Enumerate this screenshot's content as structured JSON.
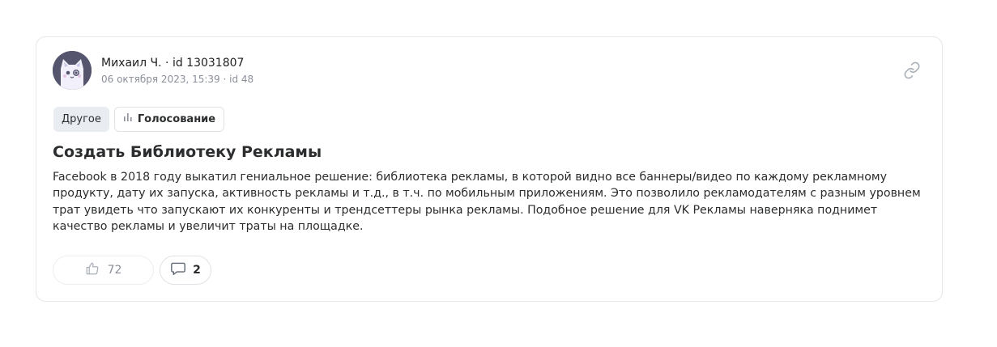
{
  "post": {
    "author": "Михаил Ч. · id 13031807",
    "meta": "06 октября 2023, 15:39 · id 48",
    "tags": {
      "category": "Другое",
      "type": "Голосование"
    },
    "title": "Создать Библиотеку Рекламы",
    "body": "Facebook в 2018 году выкатил гениальное решение: библиотека рекламы, в которой видно все баннеры/видео по каждому рекламному продукту, дату их запуска, активность рекламы и т.д., в т.ч. по мобильным приложениям. Это позволило рекламодателям с разным уровнем трат увидеть что запускают их конкуренты и трендсеттеры рынка рекламы. Подобное решение для VK Рекламы наверняка поднимет качество рекламы и увеличит траты на площадке.",
    "likes": "72",
    "comments": "2"
  },
  "icons": {
    "avatar": "cat-avatar",
    "copy_link": "link-icon",
    "vote": "bar-chart-icon",
    "like": "thumbs-up-icon",
    "comment": "comment-icon"
  }
}
